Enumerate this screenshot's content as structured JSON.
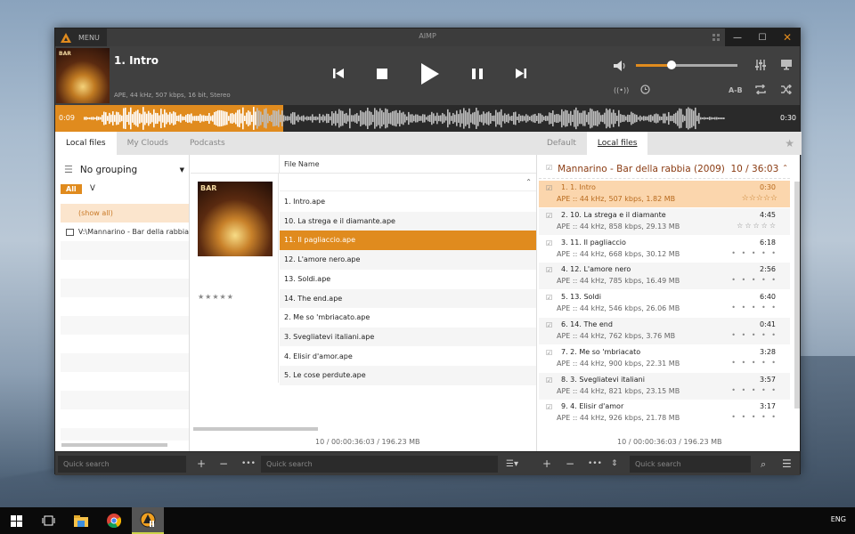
{
  "window": {
    "title": "AIMP",
    "menu_label": "MENU",
    "controls": {
      "minimize": "—",
      "maximize": "☐",
      "close": "✕"
    }
  },
  "player": {
    "track_title": "1. Intro",
    "track_info": "APE, 44 kHz, 507 kbps, 16 bit, Stereo",
    "cover_tag": "BAR",
    "volume_percent": 35,
    "ab_label": "A-B",
    "elapsed": "0:09",
    "total": "0:30",
    "progress_percent": 30
  },
  "left_tabs": [
    {
      "label": "Local files",
      "active": true
    },
    {
      "label": "My Clouds",
      "active": false
    },
    {
      "label": "Podcasts",
      "active": false
    }
  ],
  "right_tabs": [
    {
      "label": "Default",
      "active": false
    },
    {
      "label": "Local files",
      "active": true
    }
  ],
  "library": {
    "grouping_label": "No grouping",
    "filter_all": "All",
    "filter_v": "V",
    "show_all": "(show all)",
    "folder": "V:\\Mannarino - Bar della rabbia"
  },
  "files": {
    "column_header": "File Name",
    "album_rating": "★★★★★",
    "rows": [
      {
        "name": "1. Intro.ape",
        "selected": false
      },
      {
        "name": "10. La strega e il diamante.ape",
        "selected": false
      },
      {
        "name": "11. Il pagliaccio.ape",
        "selected": true
      },
      {
        "name": "12. L'amore nero.ape",
        "selected": false
      },
      {
        "name": "13. Soldi.ape",
        "selected": false
      },
      {
        "name": "14. The end.ape",
        "selected": false
      },
      {
        "name": "2. Me so 'mbriacato.ape",
        "selected": false
      },
      {
        "name": "3. Svegliatevi italiani.ape",
        "selected": false
      },
      {
        "name": "4. Elisir d'amor.ape",
        "selected": false
      },
      {
        "name": "5. Le cose perdute.ape",
        "selected": false
      }
    ],
    "status": "10 / 00:00:36:03 / 196.23 MB"
  },
  "playlist": {
    "group_title": "Mannarino - Bar della rabbia (2009)",
    "group_count": "10 / 36:03",
    "items": [
      {
        "name": "1. 1. Intro",
        "info": "APE :: 44 kHz, 507 kbps, 1.82 MB",
        "duration": "0:30",
        "rating": "☆☆☆☆☆",
        "playing": true
      },
      {
        "name": "2. 10. La strega e il diamante",
        "info": "APE :: 44 kHz, 858 kbps, 29.13 MB",
        "duration": "4:45",
        "rating": "☆☆☆☆☆",
        "playing": false
      },
      {
        "name": "3. 11. Il pagliaccio",
        "info": "APE :: 44 kHz, 668 kbps, 30.12 MB",
        "duration": "6:18",
        "rating": "• • • • •",
        "playing": false
      },
      {
        "name": "4. 12. L'amore nero",
        "info": "APE :: 44 kHz, 785 kbps, 16.49 MB",
        "duration": "2:56",
        "rating": "• • • • •",
        "playing": false
      },
      {
        "name": "5. 13. Soldi",
        "info": "APE :: 44 kHz, 546 kbps, 26.06 MB",
        "duration": "6:40",
        "rating": "• • • • •",
        "playing": false
      },
      {
        "name": "6. 14. The end",
        "info": "APE :: 44 kHz, 762 kbps, 3.76 MB",
        "duration": "0:41",
        "rating": "• • • • •",
        "playing": false
      },
      {
        "name": "7. 2. Me so 'mbriacato",
        "info": "APE :: 44 kHz, 900 kbps, 22.31 MB",
        "duration": "3:28",
        "rating": "• • • • •",
        "playing": false
      },
      {
        "name": "8. 3. Svegliatevi italiani",
        "info": "APE :: 44 kHz, 821 kbps, 23.15 MB",
        "duration": "3:57",
        "rating": "• • • • •",
        "playing": false
      },
      {
        "name": "9. 4. Elisir d'amor",
        "info": "APE :: 44 kHz, 926 kbps, 21.78 MB",
        "duration": "3:17",
        "rating": "• • • • •",
        "playing": false
      }
    ],
    "status": "10 / 00:00:36:03 / 196.23 MB"
  },
  "bottom": {
    "search_placeholder": "Quick search"
  },
  "taskbar": {
    "language": "ENG"
  },
  "colors": {
    "accent": "#e08b1e",
    "selected_bg": "#fbd6ad"
  }
}
